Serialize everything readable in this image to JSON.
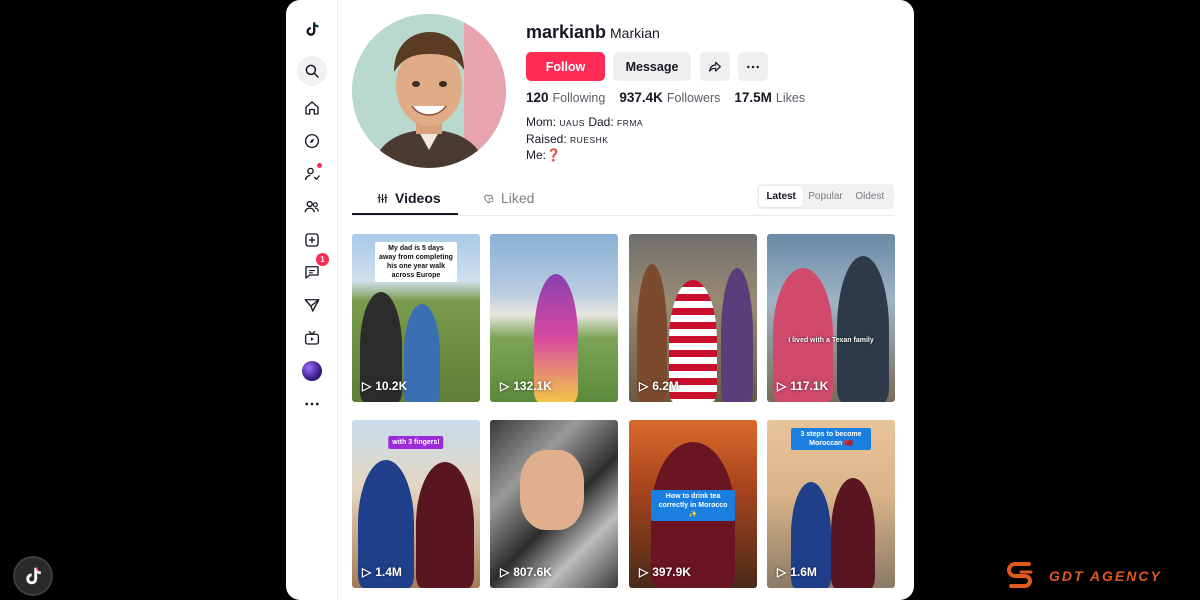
{
  "profile": {
    "username": "markianb",
    "nickname": "Markian",
    "follow_label": "Follow",
    "message_label": "Message",
    "stats": [
      {
        "value": "120",
        "label": "Following"
      },
      {
        "value": "937.4K",
        "label": "Followers"
      },
      {
        "value": "17.5M",
        "label": "Likes"
      }
    ],
    "bio": {
      "line1_prefix": "Mom:",
      "line1_mom": "UAUS",
      "line1_dad_label": "Dad:",
      "line1_dad": "FRMA",
      "line2_prefix": "Raised:",
      "line2_value": "RUESHK",
      "line3_prefix": "Me:",
      "line3_value": "❓"
    }
  },
  "sidebar": {
    "message_badge": "1"
  },
  "tabs": {
    "videos": "Videos",
    "liked": "Liked"
  },
  "sort": {
    "latest": "Latest",
    "popular": "Popular",
    "oldest": "Oldest"
  },
  "videos": [
    {
      "views": "10.2K",
      "caption": "My dad is 5 days away from completing his one year walk across Europe"
    },
    {
      "views": "132.1K",
      "caption": ""
    },
    {
      "views": "6.2M",
      "caption": ""
    },
    {
      "views": "117.1K",
      "caption": "I lived with a Texan family"
    },
    {
      "views": "1.4M",
      "caption": "with 3 fingers!"
    },
    {
      "views": "807.6K",
      "caption": ""
    },
    {
      "views": "397.9K",
      "caption": "How to drink tea correctly in Morocco ✨"
    },
    {
      "views": "1.6M",
      "caption": "3 steps to become Moroccan 🇲🇦"
    }
  ],
  "brand": {
    "agency": "GDT AGENCY"
  },
  "colors": {
    "accent": "#fe2c55",
    "brand_orange": "#e05a1b"
  }
}
